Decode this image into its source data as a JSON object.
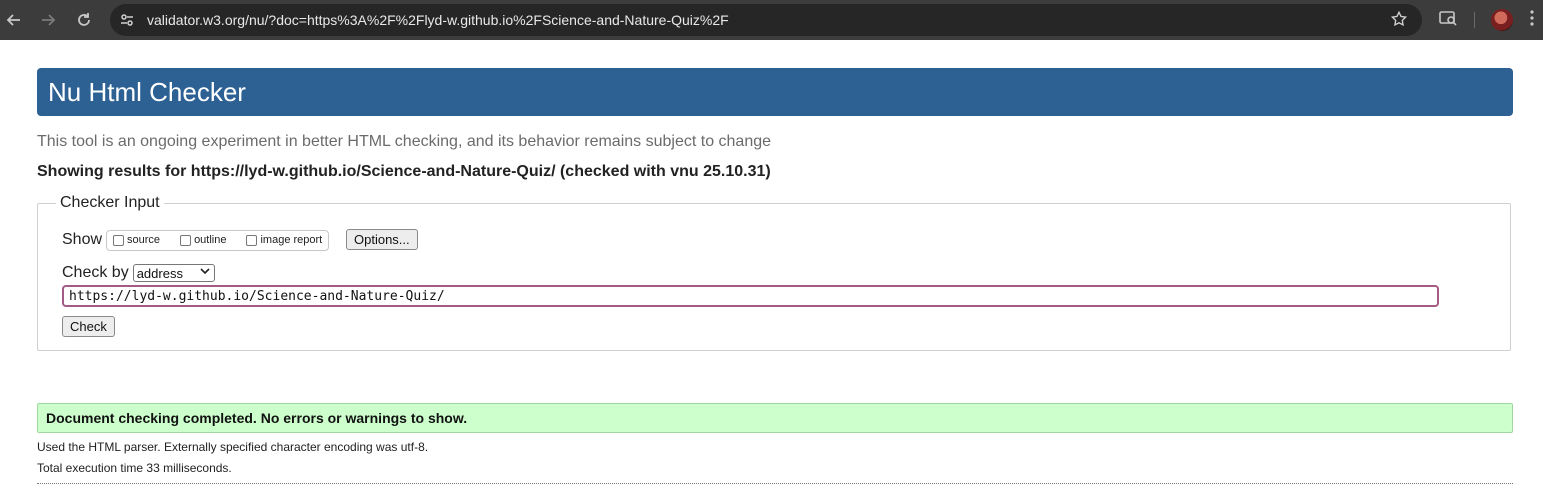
{
  "browser": {
    "url_host": "validator.w3.org",
    "url_rest": "/nu/?doc=https%3A%2F%2Flyd-w.github.io%2FScience-and-Nature-Quiz%2F",
    "icons": {
      "back": "arrow-left-icon",
      "forward": "arrow-right-icon",
      "reload": "reload-icon",
      "site_info": "site-settings-icon",
      "bookmark": "star-icon",
      "search_tabs": "tab-search-icon",
      "profile": "avatar",
      "menu": "kebab-menu-icon"
    }
  },
  "page": {
    "title": "Nu Html Checker",
    "tagline": "This tool is an ongoing experiment in better HTML checking, and its behavior remains subject to change",
    "showing_results": "Showing results for https://lyd-w.github.io/Science-and-Nature-Quiz/ (checked with vnu 25.10.31)",
    "checker_input": {
      "legend": "Checker Input",
      "show_label": "Show",
      "show_options": [
        {
          "label": "source",
          "checked": false
        },
        {
          "label": "outline",
          "checked": false
        },
        {
          "label": "image report",
          "checked": false
        }
      ],
      "options_button": "Options...",
      "check_by_label": "Check by",
      "check_by_value": "address",
      "url_value": "https://lyd-w.github.io/Science-and-Nature-Quiz/",
      "check_button": "Check"
    },
    "result_message": "Document checking completed. No errors or warnings to show.",
    "parser_info": "Used the HTML parser. Externally specified character encoding was utf-8.",
    "execution_time": "Total execution time 33 milliseconds."
  },
  "colors": {
    "header_bg": "#2d6194",
    "success_bg": "#ccffcc",
    "input_focus_border": "#a45a86"
  }
}
